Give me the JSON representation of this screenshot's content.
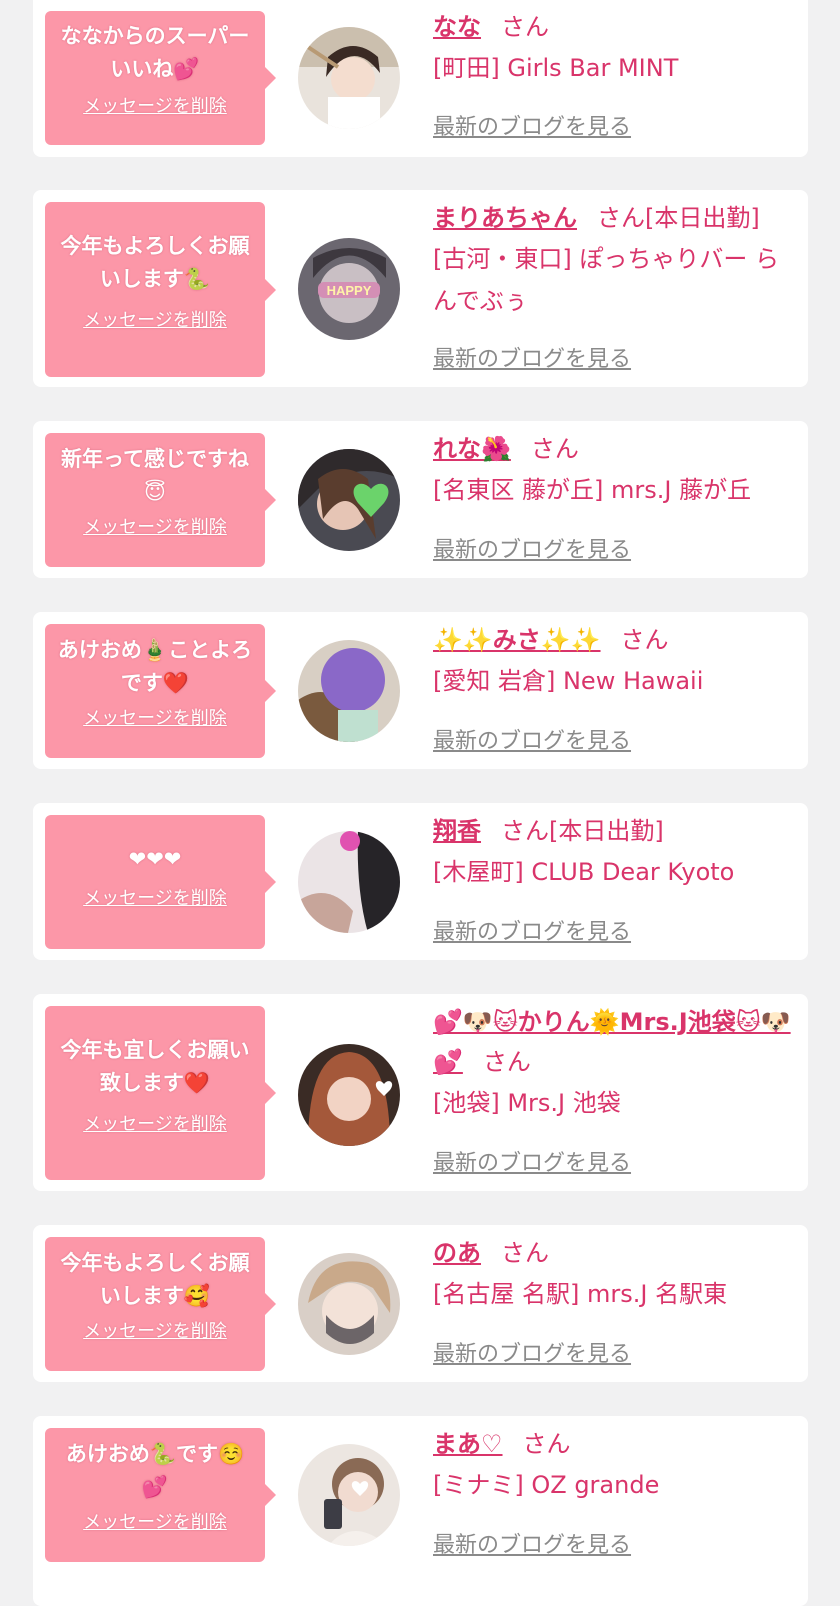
{
  "delete_label": "メッセージを削除",
  "blog_label": "最新のブログを見る",
  "colors": {
    "background": "#f1f1f2",
    "card": "#ffffff",
    "bubble": "#fc97a8",
    "accent_text": "#d9346a",
    "muted_link": "#8a8a8a"
  },
  "cards": [
    {
      "message": "ななからのスーパーいいね💕",
      "name": "なな",
      "honorific": "さん",
      "shop": "[町田] Girls Bar MINT"
    },
    {
      "message": "今年もよろしくお願いします🐍",
      "name": "まりあちゃん",
      "honorific": "さん[本日出勤]",
      "shop": "[古河・東口] ぽっちゃりバー らんでぶぅ"
    },
    {
      "message": "新年って感じですね😇",
      "name": "れな🌺",
      "honorific": "さん",
      "shop": "[名東区 藤が丘] mrs.J 藤が丘"
    },
    {
      "message": "あけおめ🎍ことよろです❤️",
      "name": "✨✨みさ✨✨",
      "honorific": "さん",
      "shop": "[愛知 岩倉] New Hawaii"
    },
    {
      "message": "❤❤❤",
      "name": "翔香",
      "honorific": "さん[本日出勤]",
      "shop": "[木屋町] CLUB Dear Kyoto"
    },
    {
      "message": "今年も宜しくお願い致します❤️",
      "name": "💕🐶🐱かりん🌞Mrs.J池袋🐱🐶💕",
      "honorific": "さん",
      "shop": "[池袋] Mrs.J 池袋"
    },
    {
      "message": "今年もよろしくお願いします🥰",
      "name": "のあ",
      "honorific": "さん",
      "shop": "[名古屋 名駅] mrs.J 名駅東"
    },
    {
      "message": "あけおめ🐍です☺️💕",
      "name": "まあ♡",
      "honorific": "さん",
      "shop": "[ミナミ] OZ grande"
    }
  ]
}
